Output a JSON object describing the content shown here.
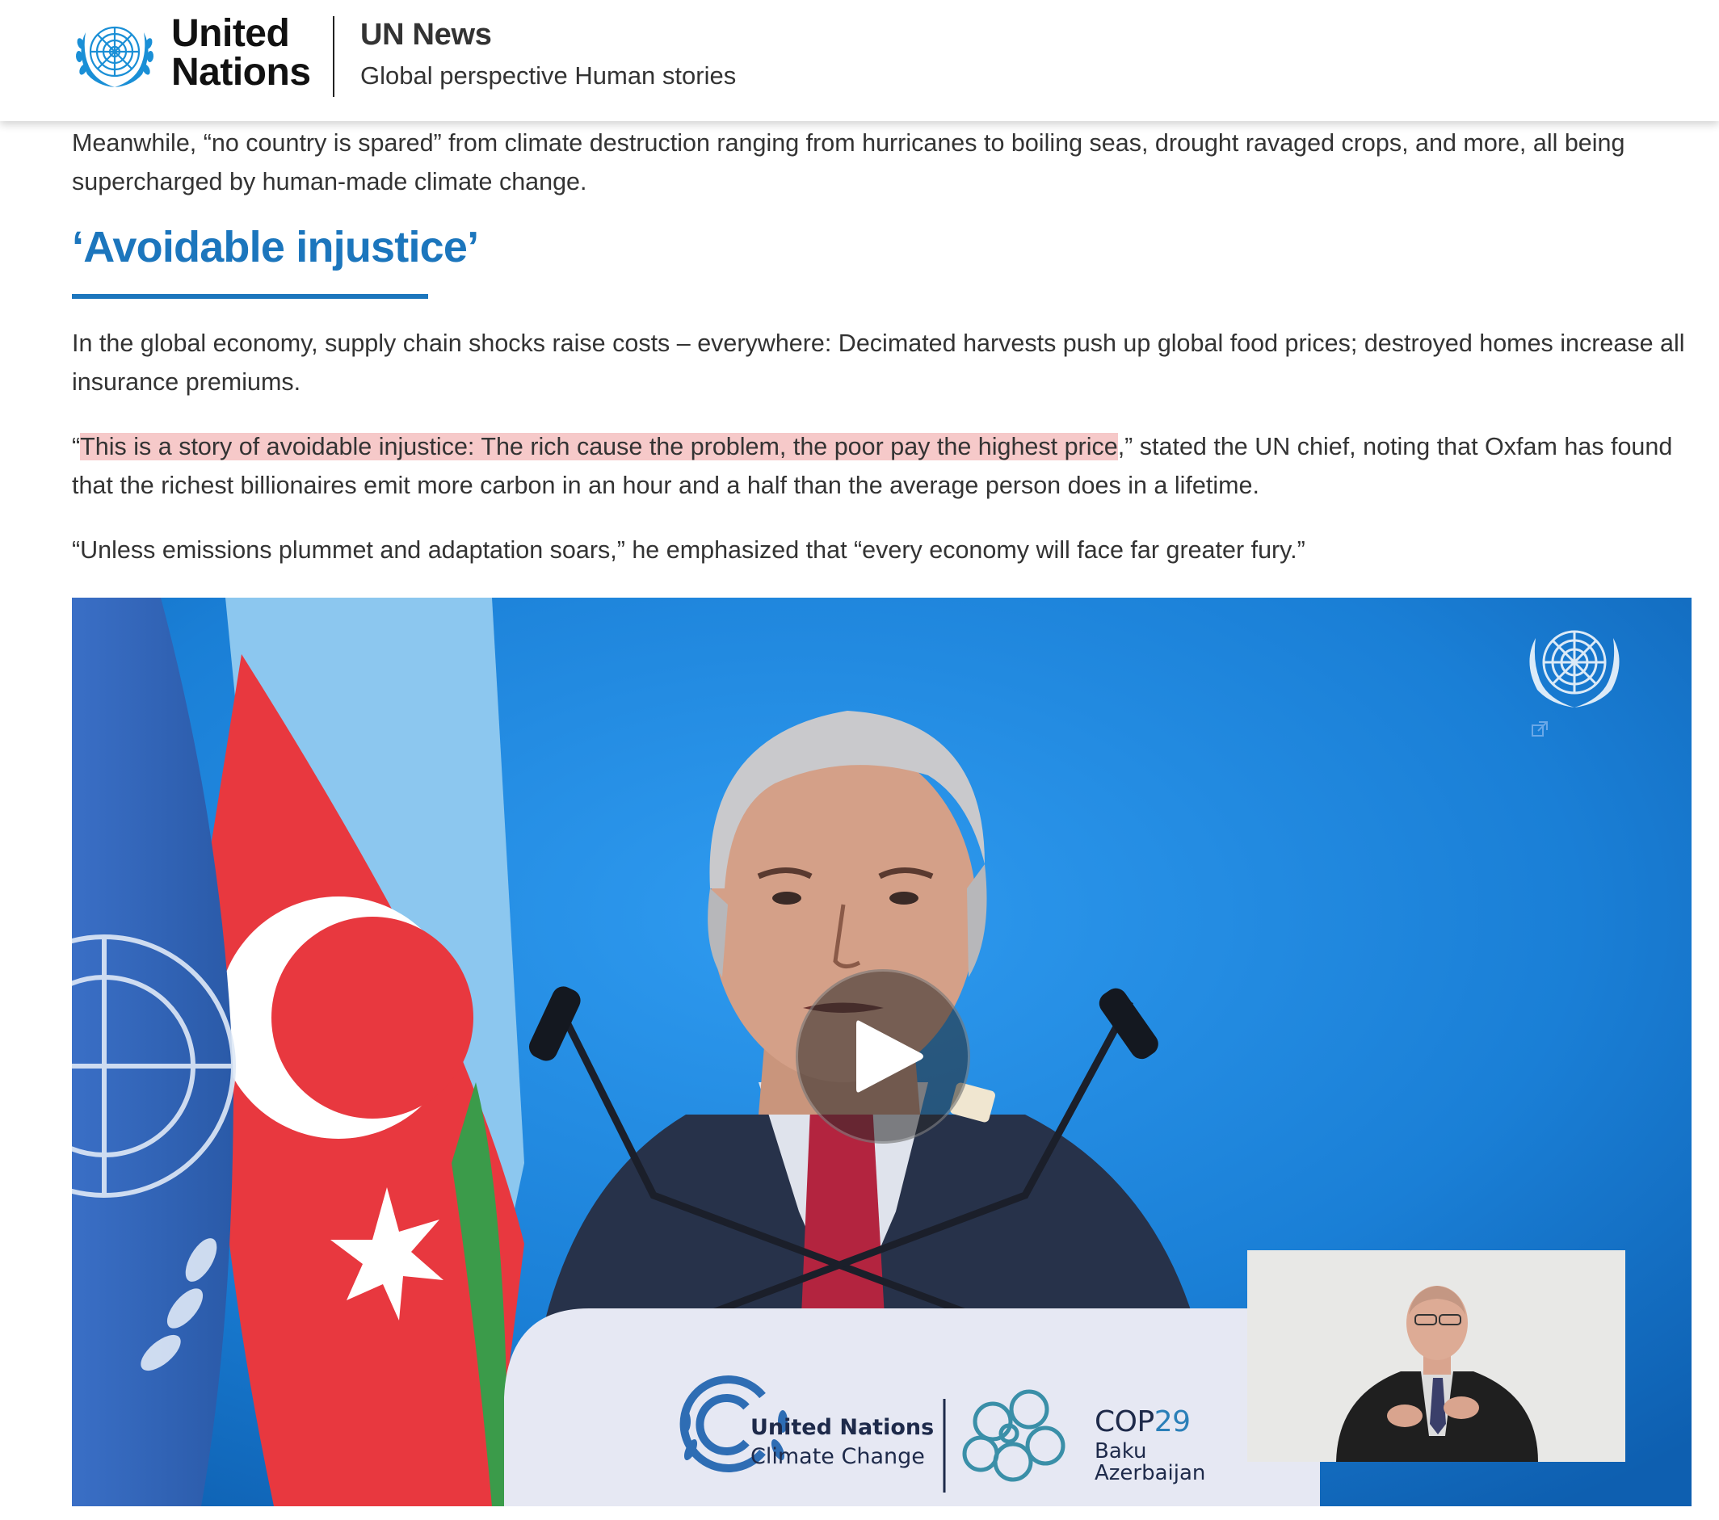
{
  "header": {
    "logo_line1": "United",
    "logo_line2": "Nations",
    "brand_title": "UN News",
    "tagline": "Global perspective Human stories"
  },
  "article": {
    "paragraph_1": "Meanwhile, “no country is spared” from climate destruction ranging from hurricanes to boiling seas, drought ravaged crops, and more, all being supercharged by human-made climate change.",
    "heading": "‘Avoidable injustice’",
    "paragraph_2": "In the global economy, supply chain shocks raise costs – everywhere: Decimated harvests push up global food prices; destroyed homes increase all insurance premiums.",
    "paragraph_3": {
      "open_quote": "“",
      "highlighted": "This is a story of avoidable injustice: The rich cause the problem, the poor pay the highest price",
      "rest": ",” stated the UN chief, noting that Oxfam has found that the richest billionaires emit more carbon in an hour and a half than the average person does in a lifetime."
    },
    "paragraph_4": "“Unless emissions plummet and adaptation soars,” he emphasized that “every economy will face far greater fury.”"
  },
  "video": {
    "podium_line1": "United Nations",
    "podium_line2": "Climate Change",
    "cop_title_text": "COP",
    "cop_title_number": "29",
    "cop_location_1": "Baku",
    "cop_location_2": "Azerbaijan",
    "play_icon": "play-icon"
  },
  "colors": {
    "heading_blue": "#1c76bd",
    "highlight": "#f6c9c9",
    "text": "#333333",
    "video_background": "#1a7fd6"
  }
}
